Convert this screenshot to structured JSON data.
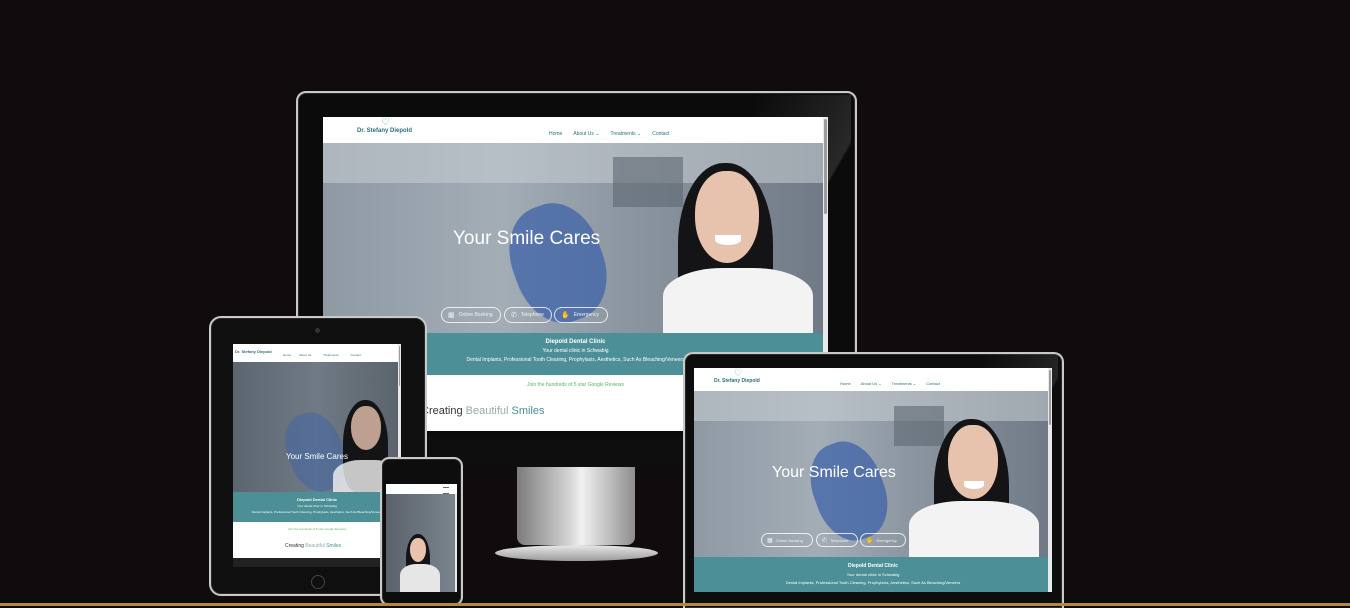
{
  "site": {
    "logo": "Dr. Stefany Diepold",
    "logo_icon": "tooth-icon",
    "nav": {
      "home": "Home",
      "about": "About Us",
      "treatments": "Treatments",
      "contact": "Contact",
      "dropdown_icon": "chevron-down-icon"
    },
    "hero_title": "Your Smile Cares",
    "buttons": {
      "booking": "Online Booking",
      "telephone": "Telephone",
      "emergency": "Emergency",
      "booking_icon": "calendar-icon",
      "telephone_icon": "phone-icon",
      "emergency_icon": "hand-icon"
    },
    "clinic_name": "Diepold Dental Clinic",
    "clinic_subtitle": "Your dental clinic in Schwabig",
    "services": "Dental Implants, Professional Tooth Cleaning, Prophylaxis, Aesthetics, Such As Bleaching/Veneers",
    "reviews": "Join the hundreds of 5 star Google Reviews",
    "creating": {
      "w1": "Creating",
      "w2": "Beautiful",
      "w3": "Smiles"
    }
  },
  "colors": {
    "background": "#100c0d",
    "accent_teal": "#4c8f96",
    "link_teal": "#2d6f7b",
    "reviews_green": "#58b468"
  }
}
